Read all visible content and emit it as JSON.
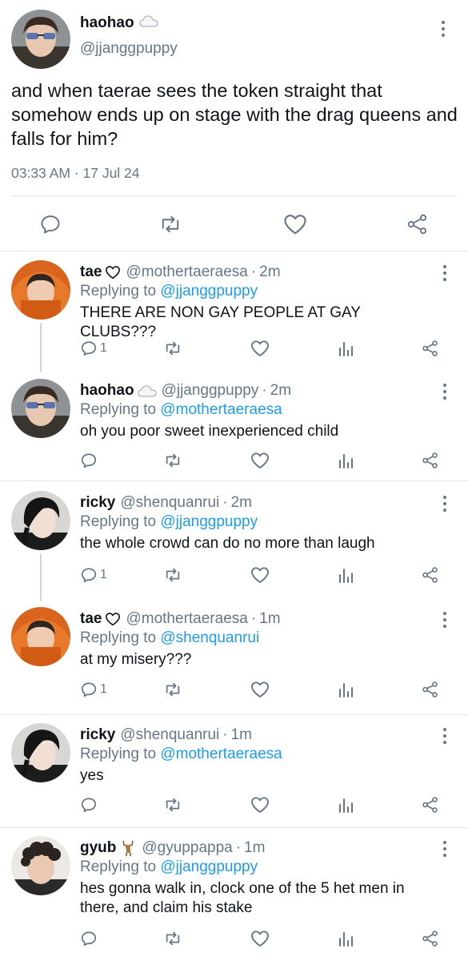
{
  "main_tweet": {
    "display_name": "haohao",
    "name_emoji": "cloud-icon",
    "handle": "@jjanggpuppy",
    "text": "and when taerae sees the token straight that somehow ends up on stage with the drag queens and falls for him?",
    "timestamp": "03:33 AM · 17 Jul 24"
  },
  "colors": {
    "text": "#0f1419",
    "secondary": "#657786",
    "link": "#1d9bf0",
    "divider": "#e1e8ed"
  },
  "replies": [
    {
      "display_name": "tae",
      "name_emoji": "heart-outline-icon",
      "handle": "@mothertaeraesa",
      "dot": "·",
      "time": "2m",
      "replying_prefix": "Replying to ",
      "replying_to": "@jjanggpuppy",
      "text": "THERE ARE NON GAY PEOPLE AT GAY CLUBS???",
      "reply_count": "1",
      "avatar": "orange-hood"
    },
    {
      "display_name": "haohao",
      "name_emoji": "cloud-icon",
      "handle": "@jjanggpuppy",
      "dot": "·",
      "time": "2m",
      "replying_prefix": "Replying to ",
      "replying_to": "@mothertaeraesa",
      "text": "oh you poor sweet inexperienced child",
      "reply_count": "",
      "avatar": "sunglasses"
    },
    {
      "display_name": "ricky",
      "name_emoji": "",
      "handle": "@shenquanrui",
      "dot": "·",
      "time": "2m",
      "replying_prefix": "Replying to ",
      "replying_to": "@jjanggpuppy",
      "text": "the whole crowd can do no more than laugh",
      "reply_count": "1",
      "avatar": "dark-hair"
    },
    {
      "display_name": "tae",
      "name_emoji": "heart-outline-icon",
      "handle": "@mothertaeraesa",
      "dot": "·",
      "time": "1m",
      "replying_prefix": "Replying to ",
      "replying_to": "@shenquanrui",
      "text": "at my misery???",
      "reply_count": "1",
      "avatar": "orange-hood"
    },
    {
      "display_name": "ricky",
      "name_emoji": "",
      "handle": "@shenquanrui",
      "dot": "·",
      "time": "1m",
      "replying_prefix": "Replying to ",
      "replying_to": "@mothertaeraesa",
      "text": "yes",
      "reply_count": "",
      "avatar": "dark-hair"
    },
    {
      "display_name": "gyub",
      "name_emoji": "deer-icon",
      "handle": "@gyuppappa",
      "dot": "·",
      "time": "1m",
      "replying_prefix": "Replying to ",
      "replying_to": "@jjanggpuppy",
      "text": "hes gonna walk in, clock one of the 5 het men in there, and claim his stake",
      "reply_count": "",
      "avatar": "curly"
    }
  ]
}
